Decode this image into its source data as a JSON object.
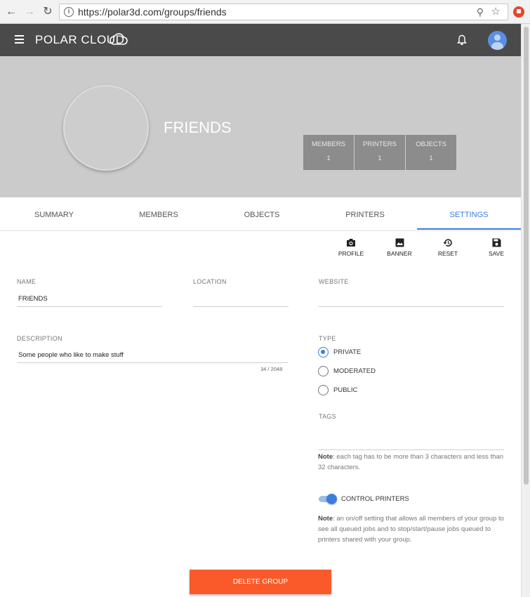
{
  "browser": {
    "url": "https://polar3d.com/groups/friends",
    "back_icon": "arrow-left-icon",
    "forward_icon": "arrow-right-icon",
    "reload_icon": "reload-icon"
  },
  "appbar": {
    "logo_text": "POLAR CLOUD",
    "bg_color": "#4a4a4a"
  },
  "group": {
    "name": "FRIENDS",
    "stats": [
      {
        "label": "MEMBERS",
        "value": "1"
      },
      {
        "label": "PRINTERS",
        "value": "1"
      },
      {
        "label": "OBJECTS",
        "value": "1"
      }
    ]
  },
  "tabs": [
    {
      "label": "SUMMARY",
      "active": false
    },
    {
      "label": "MEMBERS",
      "active": false
    },
    {
      "label": "OBJECTS",
      "active": false
    },
    {
      "label": "PRINTERS",
      "active": false
    },
    {
      "label": "SETTINGS",
      "active": true
    }
  ],
  "toolbar": {
    "profile": "PROFILE",
    "banner": "BANNER",
    "reset": "RESET",
    "save": "SAVE"
  },
  "form": {
    "name_label": "NAME",
    "name_value": "FRIENDS",
    "location_label": "LOCATION",
    "location_value": "",
    "website_label": "WEBSITE",
    "website_value": "",
    "description_label": "DESCRIPTION",
    "description_value": "Some people who like to make stuff",
    "description_counter": "34 / 2048",
    "type_label": "TYPE",
    "type_options": [
      {
        "label": "PRIVATE",
        "checked": true
      },
      {
        "label": "MODERATED",
        "checked": false
      },
      {
        "label": "PUBLIC",
        "checked": false
      }
    ],
    "tags_label": "TAGS",
    "tags_note_bold": "Note",
    "tags_note_text": ": each tag has to be more than 3 characters and less than 32 characters.",
    "control_printers_label": "CONTROL PRINTERS",
    "control_printers_on": true,
    "control_note_bold": "Note",
    "control_note_text": ": an on/off setting that allows all members of your group to see all queued jobs and to stop/start/pause jobs queued to printers shared with your group.",
    "delete_button": "DELETE GROUP"
  },
  "colors": {
    "accent": "#3b7ddd",
    "danger": "#fa5a2a",
    "banner_bg": "#cbcbcb",
    "stat_bg": "#8c8c8c"
  }
}
